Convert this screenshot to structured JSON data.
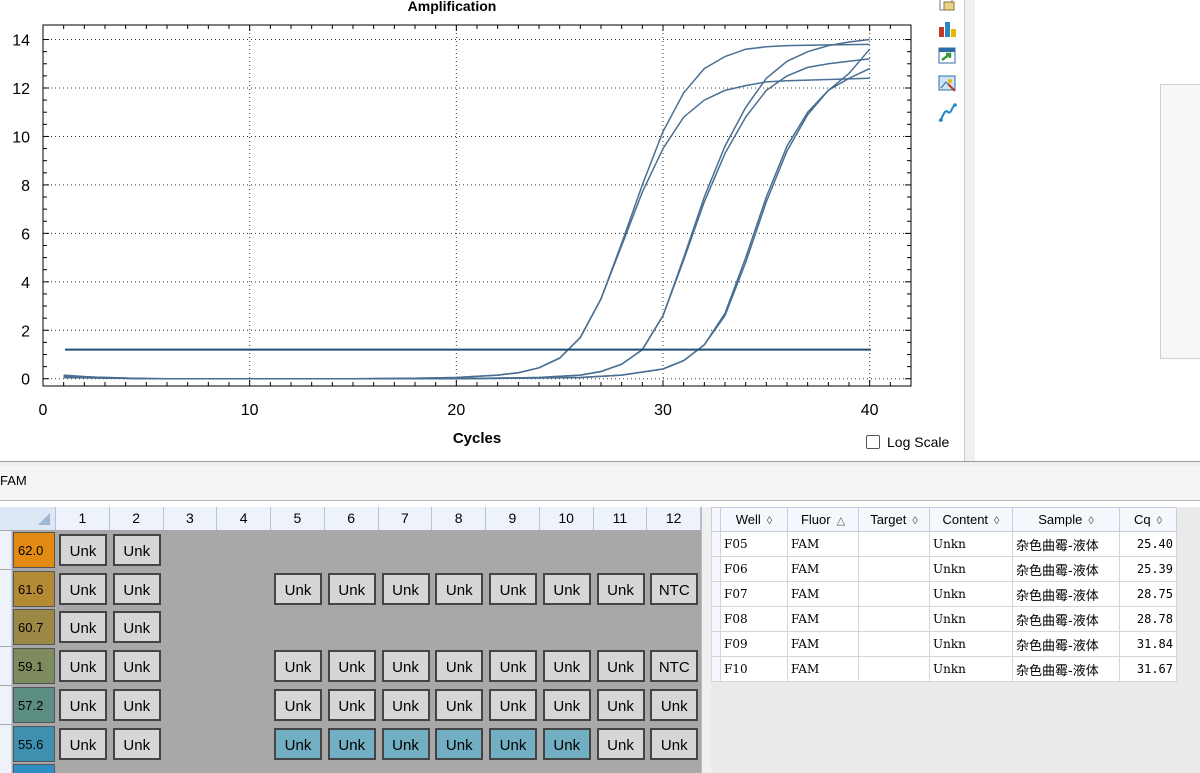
{
  "chart_data": {
    "type": "line",
    "title": "Amplification",
    "xlabel": "Cycles",
    "ylabel": "",
    "xlim": [
      0,
      42
    ],
    "ylim": [
      -0.3,
      14.6
    ],
    "xticks": [
      0,
      10,
      20,
      30,
      40
    ],
    "yticks": [
      0,
      2,
      4,
      6,
      8,
      10,
      12,
      14
    ],
    "threshold": 1.2,
    "grid": true,
    "line_color": "#4a6f93",
    "threshold_color": "#1f4e79",
    "series": [
      {
        "values": [
          [
            1,
            0.12
          ],
          [
            3,
            0.02
          ],
          [
            6,
            0.0
          ],
          [
            10,
            0.0
          ],
          [
            15,
            0.0
          ],
          [
            18,
            0.02
          ],
          [
            20,
            0.05
          ],
          [
            22,
            0.15
          ],
          [
            23,
            0.25
          ],
          [
            24,
            0.45
          ],
          [
            25,
            0.85
          ],
          [
            26,
            1.7
          ],
          [
            27,
            3.3
          ],
          [
            28,
            5.6
          ],
          [
            29,
            8.0
          ],
          [
            30,
            10.2
          ],
          [
            31,
            11.8
          ],
          [
            32,
            12.8
          ],
          [
            33,
            13.3
          ],
          [
            34,
            13.6
          ],
          [
            35,
            13.7
          ],
          [
            36,
            13.75
          ],
          [
            38,
            13.78
          ],
          [
            40,
            13.8
          ]
        ]
      },
      {
        "values": [
          [
            1,
            0.15
          ],
          [
            3,
            0.03
          ],
          [
            6,
            0.0
          ],
          [
            10,
            0.0
          ],
          [
            15,
            0.0
          ],
          [
            18,
            0.02
          ],
          [
            20,
            0.05
          ],
          [
            22,
            0.15
          ],
          [
            23,
            0.25
          ],
          [
            24,
            0.45
          ],
          [
            25,
            0.85
          ],
          [
            26,
            1.7
          ],
          [
            27,
            3.3
          ],
          [
            28,
            5.5
          ],
          [
            29,
            7.7
          ],
          [
            30,
            9.5
          ],
          [
            31,
            10.8
          ],
          [
            32,
            11.5
          ],
          [
            33,
            11.9
          ],
          [
            34,
            12.1
          ],
          [
            35,
            12.25
          ],
          [
            36,
            12.3
          ],
          [
            38,
            12.35
          ],
          [
            40,
            12.4
          ]
        ]
      },
      {
        "values": [
          [
            1,
            0.1
          ],
          [
            5,
            0.0
          ],
          [
            10,
            0.0
          ],
          [
            20,
            0.0
          ],
          [
            24,
            0.05
          ],
          [
            26,
            0.15
          ],
          [
            27,
            0.3
          ],
          [
            28,
            0.6
          ],
          [
            29,
            1.2
          ],
          [
            30,
            2.6
          ],
          [
            31,
            5.0
          ],
          [
            32,
            7.5
          ],
          [
            33,
            9.6
          ],
          [
            34,
            11.2
          ],
          [
            35,
            12.4
          ],
          [
            36,
            13.1
          ],
          [
            37,
            13.5
          ],
          [
            38,
            13.75
          ],
          [
            39,
            13.9
          ],
          [
            40,
            14.0
          ]
        ]
      },
      {
        "values": [
          [
            1,
            0.1
          ],
          [
            5,
            0.0
          ],
          [
            10,
            0.0
          ],
          [
            20,
            0.0
          ],
          [
            24,
            0.05
          ],
          [
            26,
            0.15
          ],
          [
            27,
            0.3
          ],
          [
            28,
            0.6
          ],
          [
            29,
            1.2
          ],
          [
            30,
            2.6
          ],
          [
            31,
            4.9
          ],
          [
            32,
            7.3
          ],
          [
            33,
            9.3
          ],
          [
            34,
            10.8
          ],
          [
            35,
            11.9
          ],
          [
            36,
            12.5
          ],
          [
            37,
            12.85
          ],
          [
            38,
            13.0
          ],
          [
            39,
            13.1
          ],
          [
            40,
            13.2
          ]
        ]
      },
      {
        "values": [
          [
            1,
            0.05
          ],
          [
            5,
            0.0
          ],
          [
            10,
            0.0
          ],
          [
            20,
            0.0
          ],
          [
            26,
            0.05
          ],
          [
            28,
            0.15
          ],
          [
            30,
            0.4
          ],
          [
            31,
            0.75
          ],
          [
            32,
            1.4
          ],
          [
            33,
            2.6
          ],
          [
            34,
            4.8
          ],
          [
            35,
            7.3
          ],
          [
            36,
            9.4
          ],
          [
            37,
            10.9
          ],
          [
            38,
            11.9
          ],
          [
            39,
            12.6
          ],
          [
            40,
            13.6
          ]
        ]
      },
      {
        "values": [
          [
            1,
            0.05
          ],
          [
            5,
            0.0
          ],
          [
            10,
            0.0
          ],
          [
            20,
            0.0
          ],
          [
            26,
            0.05
          ],
          [
            28,
            0.15
          ],
          [
            30,
            0.4
          ],
          [
            31,
            0.75
          ],
          [
            32,
            1.4
          ],
          [
            33,
            2.7
          ],
          [
            34,
            5.0
          ],
          [
            35,
            7.5
          ],
          [
            36,
            9.6
          ],
          [
            37,
            11.0
          ],
          [
            38,
            11.9
          ],
          [
            39,
            12.4
          ],
          [
            40,
            12.8
          ]
        ]
      }
    ]
  },
  "log_scale": {
    "label": "Log Scale",
    "checked": false
  },
  "fluor_label": "FAM",
  "toolbar_icons": [
    "copy-icon",
    "export-chart-icon",
    "export-icon",
    "image-settings-icon",
    "curve-icon"
  ],
  "plate": {
    "columns": [
      "1",
      "2",
      "3",
      "4",
      "5",
      "6",
      "7",
      "8",
      "9",
      "10",
      "11",
      "12"
    ],
    "rows": [
      {
        "temp": "62.0",
        "color": "#e38a13",
        "cells": [
          "Unk",
          "Unk",
          "",
          "",
          "",
          "",
          "",
          "",
          "",
          "",
          "",
          ""
        ],
        "selected": []
      },
      {
        "temp": "61.6",
        "color": "#b58a34",
        "cells": [
          "Unk",
          "Unk",
          "",
          "",
          "Unk",
          "Unk",
          "Unk",
          "Unk",
          "Unk",
          "Unk",
          "Unk",
          "NTC"
        ],
        "selected": []
      },
      {
        "temp": "60.7",
        "color": "#9b8844",
        "cells": [
          "Unk",
          "Unk",
          "",
          "",
          "",
          "",
          "",
          "",
          "",
          "",
          "",
          ""
        ],
        "selected": []
      },
      {
        "temp": "59.1",
        "color": "#7e8b5e",
        "cells": [
          "Unk",
          "Unk",
          "",
          "",
          "Unk",
          "Unk",
          "Unk",
          "Unk",
          "Unk",
          "Unk",
          "Unk",
          "NTC"
        ],
        "selected": []
      },
      {
        "temp": "57.2",
        "color": "#5c8d83",
        "cells": [
          "Unk",
          "Unk",
          "",
          "",
          "Unk",
          "Unk",
          "Unk",
          "Unk",
          "Unk",
          "Unk",
          "Unk",
          "Unk"
        ],
        "selected": []
      },
      {
        "temp": "55.6",
        "color": "#3f8fb0",
        "cells": [
          "Unk",
          "Unk",
          "",
          "",
          "Unk",
          "Unk",
          "Unk",
          "Unk",
          "Unk",
          "Unk",
          "Unk",
          "Unk"
        ],
        "selected": [
          4,
          5,
          6,
          7,
          8,
          9
        ]
      },
      {
        "temp": "",
        "color": "#2f8fc4",
        "cells": [
          "",
          "",
          "",
          "",
          "",
          "",
          "",
          "",
          "",
          "",
          "",
          ""
        ],
        "selected": []
      }
    ]
  },
  "results": {
    "headers": [
      "Well",
      "Fluor",
      "Target",
      "Content",
      "Sample",
      "Cq"
    ],
    "rows": [
      {
        "well": "F05",
        "fluor": "FAM",
        "target": "",
        "content": "Unkn",
        "sample": "杂色曲霉-液体",
        "cq": "25.40"
      },
      {
        "well": "F06",
        "fluor": "FAM",
        "target": "",
        "content": "Unkn",
        "sample": "杂色曲霉-液体",
        "cq": "25.39"
      },
      {
        "well": "F07",
        "fluor": "FAM",
        "target": "",
        "content": "Unkn",
        "sample": "杂色曲霉-液体",
        "cq": "28.75"
      },
      {
        "well": "F08",
        "fluor": "FAM",
        "target": "",
        "content": "Unkn",
        "sample": "杂色曲霉-液体",
        "cq": "28.78"
      },
      {
        "well": "F09",
        "fluor": "FAM",
        "target": "",
        "content": "Unkn",
        "sample": "杂色曲霉-液体",
        "cq": "31.84"
      },
      {
        "well": "F10",
        "fluor": "FAM",
        "target": "",
        "content": "Unkn",
        "sample": "杂色曲霉-液体",
        "cq": "31.67"
      }
    ]
  }
}
